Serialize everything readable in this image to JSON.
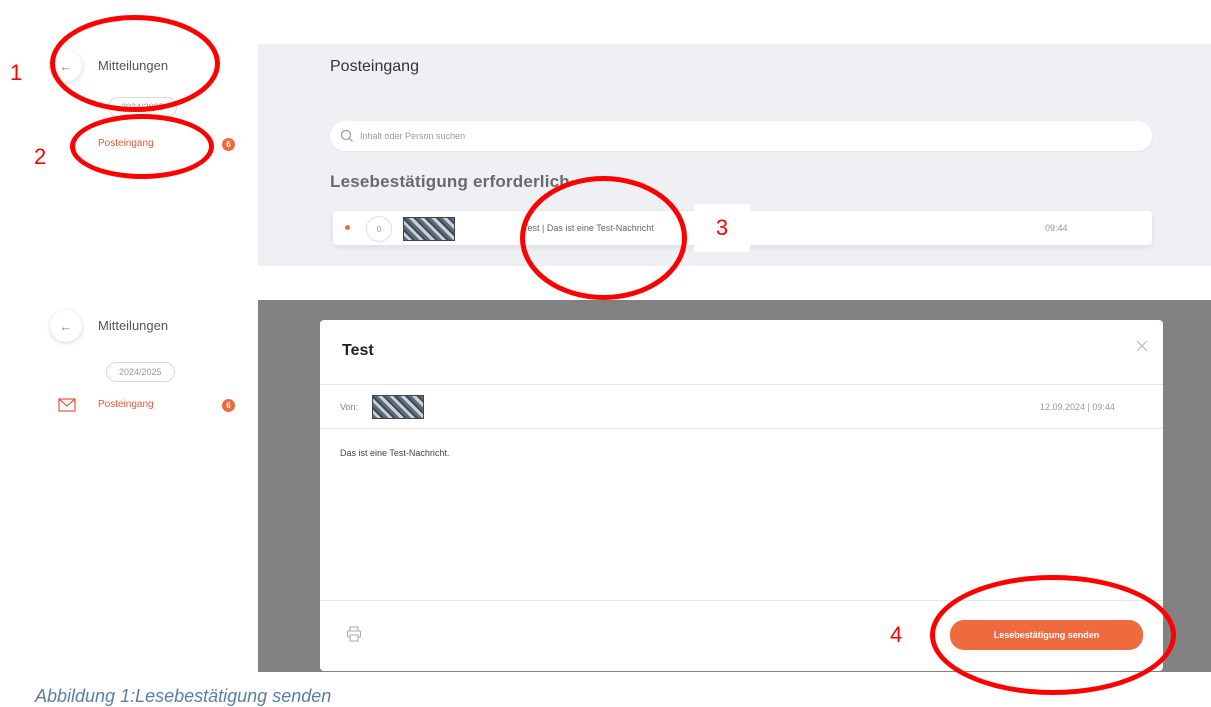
{
  "panel_top": {
    "sidebar": {
      "back_icon": "arrow-left-icon",
      "title": "Mitteilungen",
      "year": "2024/2025",
      "nav_item": "Posteingang",
      "badge": "6"
    },
    "main": {
      "heading": "Posteingang",
      "search_placeholder": "Inhalt oder Person suchen",
      "section_title": "Lesebestätigung erforderlich",
      "message": {
        "indicator": "0",
        "text": "Test | Das ist eine Test-Nachricht",
        "time": "09:44"
      }
    }
  },
  "panel_bottom": {
    "sidebar": {
      "title": "Mitteilungen",
      "year": "2024/2025",
      "nav_item": "Posteingang",
      "badge": "6"
    },
    "modal": {
      "title": "Test",
      "from_label": "Von:",
      "date": "12.09.2024 | 09:44",
      "body": "Das ist eine Test-Nachricht.",
      "button": "Lesebestätigung senden"
    }
  },
  "annotations": [
    "1",
    "2",
    "3",
    "4"
  ],
  "caption": "Abbildung 1:Lesebestätigung senden",
  "colors": {
    "accent": "#ef6a3f",
    "annotation": "#ff0000",
    "caption": "#5a7da8"
  }
}
